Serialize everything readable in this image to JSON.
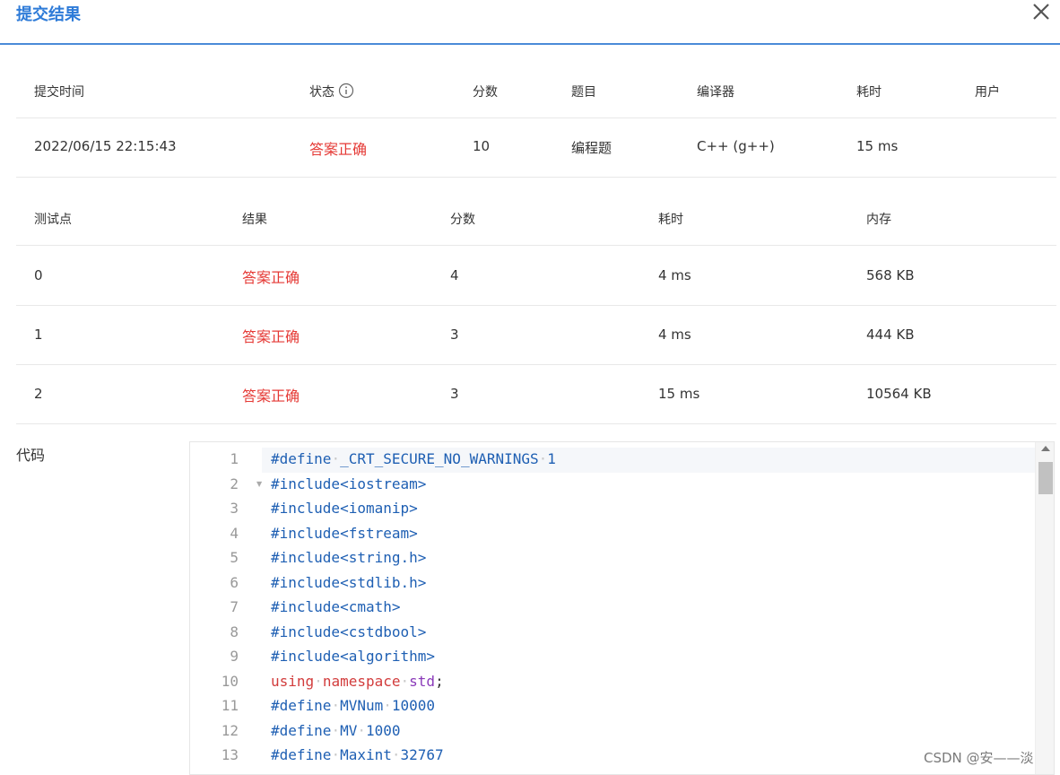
{
  "dialog": {
    "title": "提交结果",
    "close_icon": "close-icon"
  },
  "summary": {
    "headers": [
      "提交时间",
      "状态",
      "分数",
      "题目",
      "编译器",
      "耗时",
      "用户"
    ],
    "row": {
      "time": "2022/06/15 22:15:43",
      "status": "答案正确",
      "score": "10",
      "problem": "编程题",
      "compiler": "C++ (g++)",
      "elapsed": "15 ms",
      "user": ""
    }
  },
  "testcases": {
    "headers": [
      "测试点",
      "结果",
      "分数",
      "耗时",
      "内存"
    ],
    "rows": [
      {
        "id": "0",
        "result": "答案正确",
        "score": "4",
        "time": "4 ms",
        "memory": "568 KB"
      },
      {
        "id": "1",
        "result": "答案正确",
        "score": "3",
        "time": "4 ms",
        "memory": "444 KB"
      },
      {
        "id": "2",
        "result": "答案正确",
        "score": "3",
        "time": "15 ms",
        "memory": "10564 KB"
      }
    ]
  },
  "code": {
    "label": "代码",
    "lines": [
      {
        "num": "1",
        "text": "#define·_CRT_SECURE_NO_WARNINGS·1"
      },
      {
        "num": "2",
        "text": "#include<iostream>"
      },
      {
        "num": "3",
        "text": "#include<iomanip>"
      },
      {
        "num": "4",
        "text": "#include<fstream>"
      },
      {
        "num": "5",
        "text": "#include<string.h>"
      },
      {
        "num": "6",
        "text": "#include<stdlib.h>"
      },
      {
        "num": "7",
        "text": "#include<cmath>"
      },
      {
        "num": "8",
        "text": "#include<cstdbool>"
      },
      {
        "num": "9",
        "text": "#include<algorithm>"
      },
      {
        "num": "10",
        "text": "using·namespace·std;"
      },
      {
        "num": "11",
        "text": "#define·MVNum·10000"
      },
      {
        "num": "12",
        "text": "#define·MV·1000"
      },
      {
        "num": "13",
        "text": "#define·Maxint·32767"
      }
    ]
  },
  "colors": {
    "accent": "#2e7bd8",
    "success": "#e53935",
    "code_macro": "#1e5fb3",
    "code_keyword": "#d23c3c",
    "code_namespace": "#8a3ab9"
  },
  "watermark": "CSDN @安——淡"
}
